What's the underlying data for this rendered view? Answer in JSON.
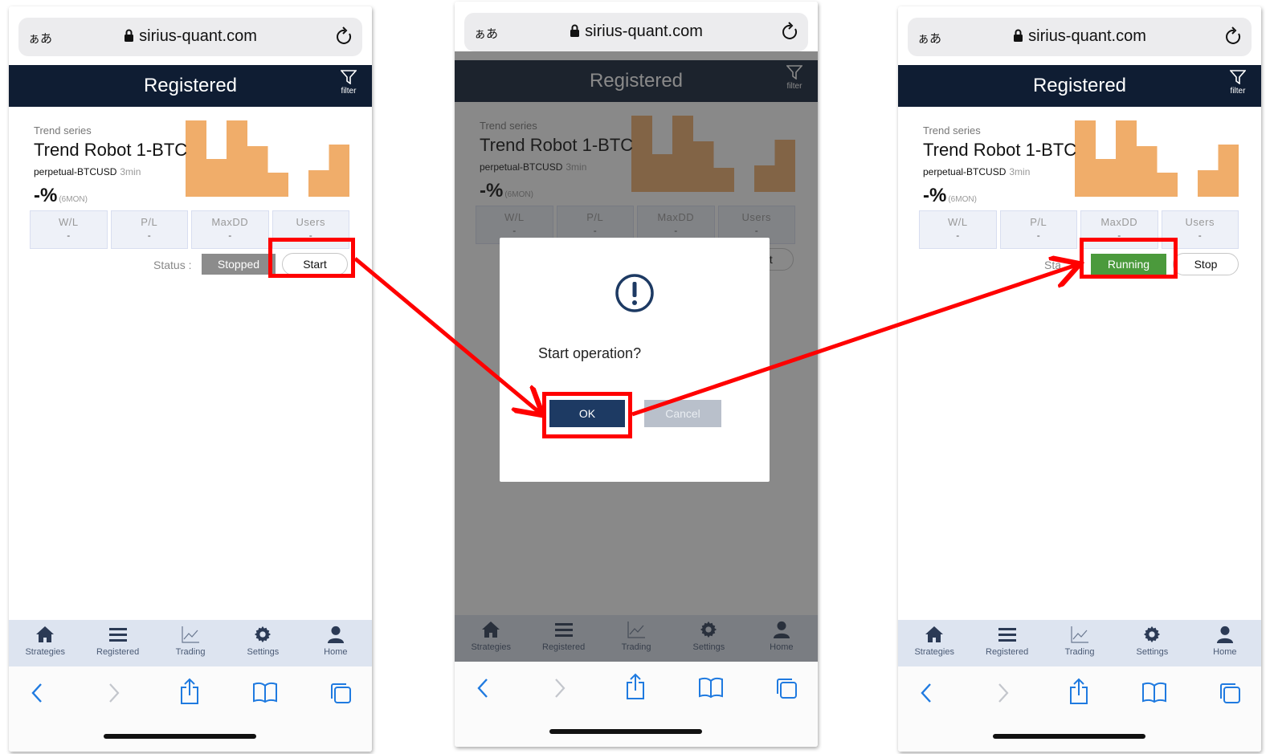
{
  "browser": {
    "text_size_button": "ぁあ",
    "url": "sirius-quant.com"
  },
  "header": {
    "title": "Registered",
    "filter_label": "filter"
  },
  "card": {
    "series": "Trend series",
    "name": "Trend Robot 1-BTC",
    "pair": "perpetual-BTCUSD",
    "timeframe": "3min",
    "performance": "-%",
    "period": "(6MON)",
    "metrics": [
      {
        "label": "W/L",
        "value": "-"
      },
      {
        "label": "P/L",
        "value": "-"
      },
      {
        "label": "MaxDD",
        "value": "-"
      },
      {
        "label": "Users",
        "value": "-"
      }
    ],
    "status_label": "Status :",
    "chart_color": "#f0ad6a",
    "chart_values": [
      0.95,
      0.47,
      0.95,
      0.63,
      0.3,
      0.0,
      0.33,
      0.65
    ]
  },
  "screens": {
    "before": {
      "state": "Stopped",
      "action": "Start"
    },
    "dialog": {
      "message": "Start  operation?",
      "ok": "OK",
      "cancel": "Cancel"
    },
    "after": {
      "state": "Running",
      "action": "Stop",
      "status_label_partial": "Sta"
    }
  },
  "tabs": [
    {
      "label": "Strategies",
      "icon": "home-icon"
    },
    {
      "label": "Registered",
      "icon": "list-icon"
    },
    {
      "label": "Trading",
      "icon": "chart-icon"
    },
    {
      "label": "Settings",
      "icon": "gear-icon"
    },
    {
      "label": "Home",
      "icon": "user-icon"
    }
  ],
  "colors": {
    "header": "#0f1d33",
    "highlight": "#ff0000",
    "running": "#4b9a3c",
    "stopped": "#8c8c8c",
    "ok_button": "#1d3a63",
    "ios_blue": "#1f7ae0"
  }
}
